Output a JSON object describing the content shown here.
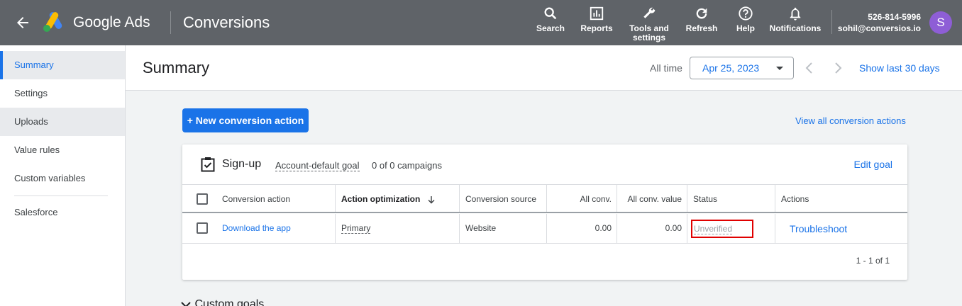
{
  "topbar": {
    "brand": "Google Ads",
    "page_name": "Conversions",
    "tools": [
      {
        "label": "Search",
        "icon": "search-icon"
      },
      {
        "label": "Reports",
        "icon": "reports-icon"
      },
      {
        "label": "Tools and settings",
        "icon": "wrench-icon"
      },
      {
        "label": "Refresh",
        "icon": "refresh-icon"
      },
      {
        "label": "Help",
        "icon": "help-icon"
      },
      {
        "label": "Notifications",
        "icon": "bell-icon"
      }
    ],
    "account_id": "526-814-5996",
    "account_email": "sohil@conversios.io",
    "avatar_letter": "S"
  },
  "sidebar": {
    "items": [
      {
        "label": "Summary"
      },
      {
        "label": "Settings"
      },
      {
        "label": "Uploads"
      },
      {
        "label": "Value rules"
      },
      {
        "label": "Custom variables"
      },
      {
        "label": "Salesforce"
      }
    ]
  },
  "header": {
    "title": "Summary",
    "range_label": "All time",
    "date": "Apr 25, 2023",
    "show_last": "Show last 30 days"
  },
  "main": {
    "new_button": "+ New conversion action",
    "view_all": "View all conversion actions"
  },
  "goal": {
    "title": "Sign-up",
    "default_label": "Account-default goal",
    "campaigns": "0 of 0 campaigns",
    "edit": "Edit goal"
  },
  "table": {
    "headers": {
      "action": "Conversion action",
      "optimization": "Action optimization",
      "source": "Conversion source",
      "all_conv": "All conv.",
      "all_conv_value": "All conv. value",
      "status": "Status",
      "actions": "Actions"
    },
    "rows": [
      {
        "action": "Download the app",
        "optimization": "Primary",
        "source": "Website",
        "all_conv": "0.00",
        "all_conv_value": "0.00",
        "status": "Unverified",
        "actions": "Troubleshoot"
      }
    ],
    "pager": "1 - 1 of 1"
  },
  "footer": {
    "custom_goals": "Custom goals"
  },
  "colors": {
    "topbar": "#5f6368",
    "accent": "#1a73e8",
    "highlight": "#e00000"
  }
}
